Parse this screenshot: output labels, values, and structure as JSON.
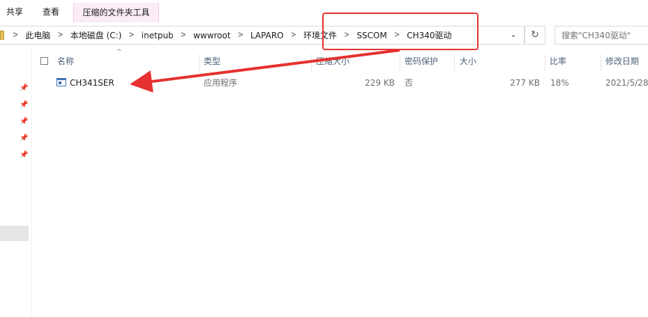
{
  "ribbon": {
    "tabs": [
      "共享",
      "查看"
    ],
    "context_tab": "压缩的文件夹工具"
  },
  "address": {
    "breadcrumbs": [
      "此电脑",
      "本地磁盘 (C:)",
      "inetpub",
      "wwwroot",
      "LAPARO",
      "环境文件",
      "SSCOM",
      "CH340驱动"
    ],
    "separator_icon": "chevron-right-icon",
    "dropdown_icon": "chevron-down-icon",
    "refresh_icon": "refresh-icon",
    "search_placeholder": "搜索\"CH340驱动\""
  },
  "columns": {
    "name": "名称",
    "type": "类型",
    "packed_size": "压缩大小",
    "password": "密码保护",
    "size": "大小",
    "ratio": "比率",
    "modified": "修改日期"
  },
  "files": [
    {
      "icon": "application-icon",
      "name": "CH341SER",
      "type": "应用程序",
      "packed_size": "229 KB",
      "password": "否",
      "size": "277 KB",
      "ratio": "18%",
      "modified": "2021/5/28"
    }
  ],
  "nav": {
    "pinned_icon": "pin-icon",
    "pinned_count": 5
  },
  "annotation": {
    "color": "#e5312f"
  }
}
